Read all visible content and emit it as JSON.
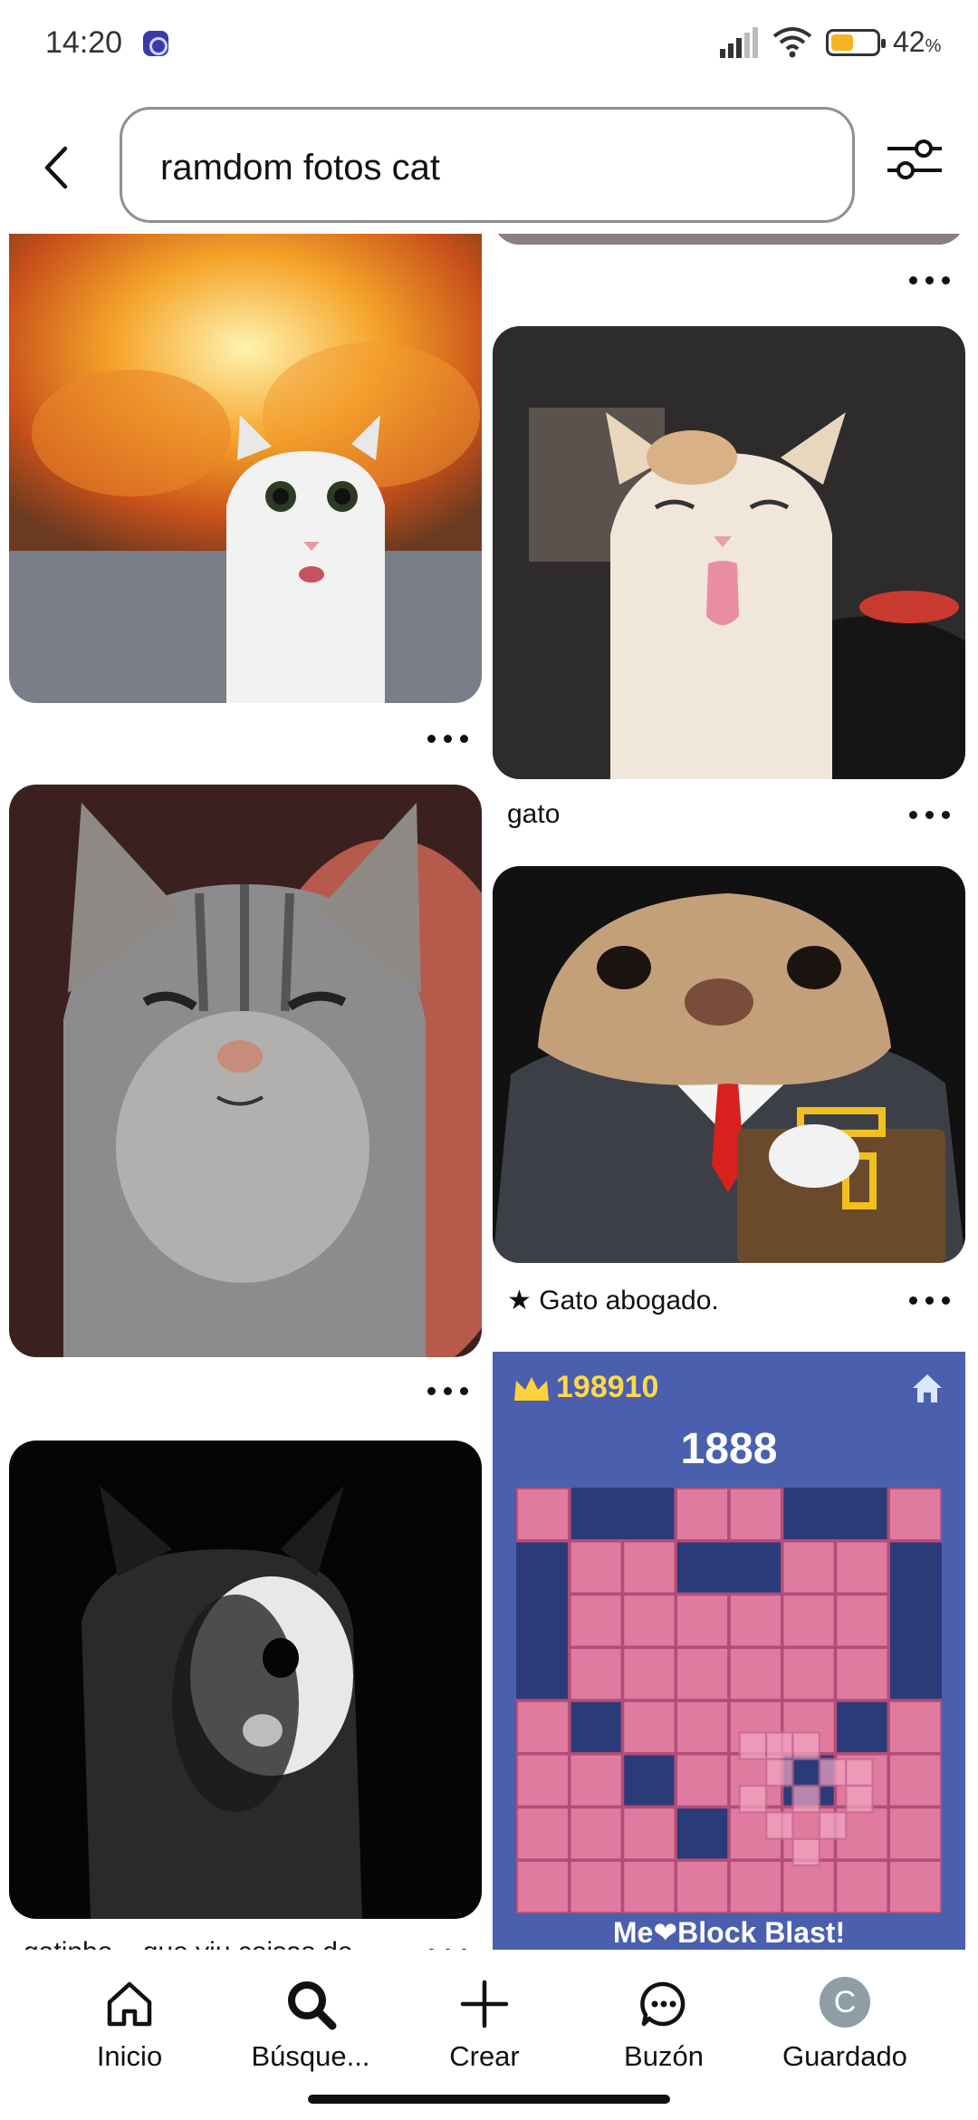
{
  "status_bar": {
    "time": "14:20",
    "battery": "42",
    "battery_unit": "%"
  },
  "search": {
    "query": "ramdom fotos cat"
  },
  "pins": [
    {
      "title": "",
      "image": "white cat in front of explosion"
    },
    {
      "title": "gato",
      "image": "white cat sticking out tongue"
    },
    {
      "title": "",
      "image": "tabby cat smiling"
    },
    {
      "title": "★ Gato abogado.",
      "image": "cartoon cat in suit with briefcase"
    },
    {
      "title": "gatinho... que viu coisas de...",
      "image": "black and white cat in dark"
    }
  ],
  "ad": {
    "score": "198910",
    "big_number": "1888",
    "footer": "Me❤Block Blast!"
  },
  "nav": [
    {
      "label": "Inicio",
      "icon": "home-icon"
    },
    {
      "label": "Búsque...",
      "icon": "search-icon"
    },
    {
      "label": "Crear",
      "icon": "plus-icon"
    },
    {
      "label": "Buzón",
      "icon": "chat-icon"
    },
    {
      "label": "Guardado",
      "icon": "avatar",
      "avatar_letter": "C"
    }
  ]
}
